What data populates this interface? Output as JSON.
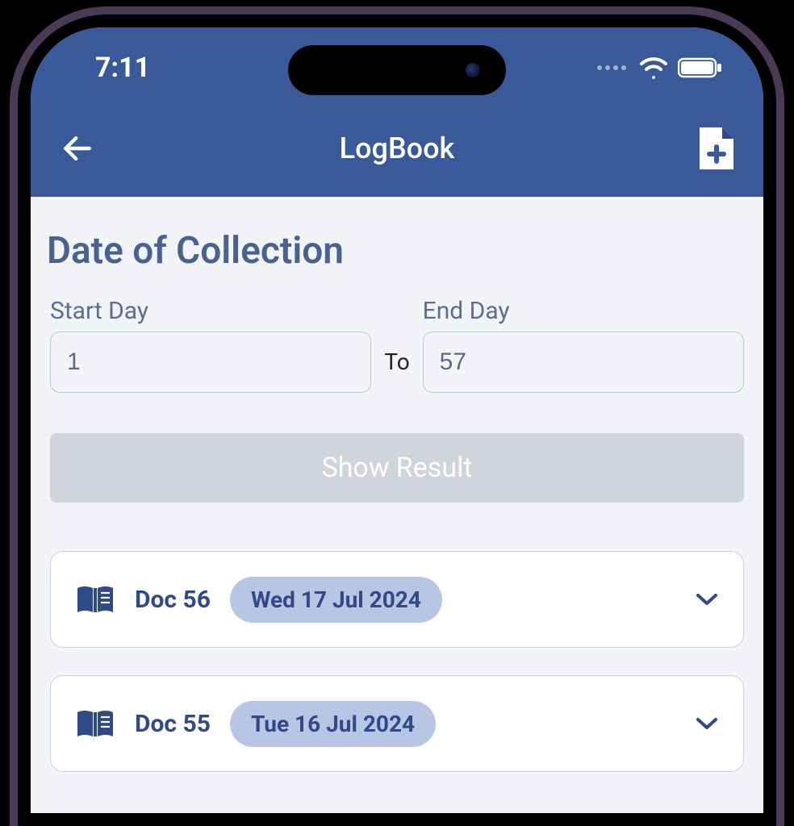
{
  "status": {
    "time": "7:11"
  },
  "nav": {
    "title": "LogBook"
  },
  "section": {
    "title": "Date of Collection"
  },
  "filter": {
    "start_label": "Start Day",
    "end_label": "End Day",
    "to_label": "To",
    "start_value": "1",
    "end_value": "57",
    "submit_label": "Show Result"
  },
  "docs": [
    {
      "name": "Doc 56",
      "date": "Wed 17 Jul 2024"
    },
    {
      "name": "Doc 55",
      "date": "Tue 16 Jul 2024"
    }
  ],
  "colors": {
    "brand": "#3a5998",
    "accent_light": "#b8c6e6",
    "text_muted": "#5a6f92"
  }
}
